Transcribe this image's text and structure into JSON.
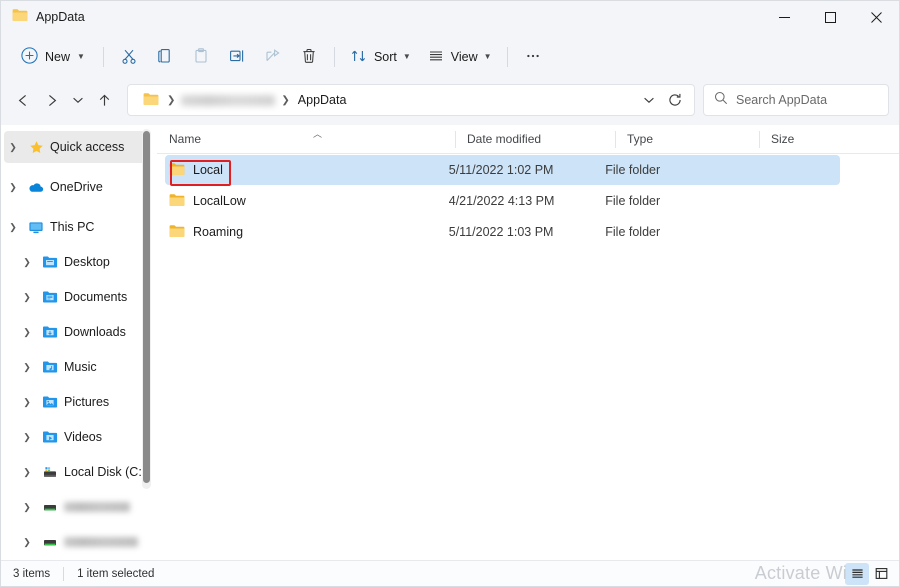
{
  "window": {
    "title": "AppData",
    "title_icon": "folder-icon",
    "controls": {
      "minimize": "minimize-icon",
      "maximize": "maximize-icon",
      "close": "close-icon"
    }
  },
  "toolbar": {
    "new_label": "New",
    "items": [
      {
        "name": "new-button",
        "label": "New",
        "icon": "plus-circle-icon",
        "has_chevron": true,
        "disabled": false
      },
      {
        "name": "cut-button",
        "label": "",
        "icon": "scissors-icon",
        "has_chevron": false,
        "disabled": false
      },
      {
        "name": "copy-button",
        "label": "",
        "icon": "copy-icon",
        "has_chevron": false,
        "disabled": false
      },
      {
        "name": "paste-button",
        "label": "",
        "icon": "paste-icon",
        "has_chevron": false,
        "disabled": true
      },
      {
        "name": "rename-button",
        "label": "",
        "icon": "rename-icon",
        "has_chevron": false,
        "disabled": false
      },
      {
        "name": "share-button",
        "label": "",
        "icon": "share-icon",
        "has_chevron": false,
        "disabled": true
      },
      {
        "name": "delete-button",
        "label": "",
        "icon": "trash-icon",
        "has_chevron": false,
        "disabled": false
      },
      {
        "name": "sort-button",
        "label": "Sort",
        "icon": "sort-icon",
        "has_chevron": true,
        "disabled": false
      },
      {
        "name": "view-button",
        "label": "View",
        "icon": "view-icon",
        "has_chevron": true,
        "disabled": false
      },
      {
        "name": "more-button",
        "label": "",
        "icon": "ellipsis-icon",
        "has_chevron": false,
        "disabled": false
      }
    ],
    "sort_label": "Sort",
    "view_label": "View"
  },
  "addressbar": {
    "back_icon": "back-arrow-icon",
    "forward_icon": "forward-arrow-icon",
    "recent_icon": "chevron-down-icon",
    "up_icon": "up-arrow-icon",
    "refresh_icon": "refresh-icon",
    "dropdown_icon": "chevron-down-icon",
    "breadcrumbs": [
      {
        "label": "",
        "icon": "folder-icon",
        "blurred": false
      },
      {
        "label": "",
        "icon": "",
        "blurred": true
      },
      {
        "label": "AppData",
        "icon": "",
        "blurred": false
      }
    ],
    "separator": "›"
  },
  "search": {
    "placeholder": "Search AppData",
    "value": "",
    "icon": "search-icon"
  },
  "sidebar": {
    "items": [
      {
        "label": "Quick access",
        "icon": "star-icon",
        "expander": "chevron-right",
        "indent": false,
        "selected": true,
        "blurred": false
      },
      {
        "label": "OneDrive",
        "icon": "cloud-icon",
        "expander": "chevron-right",
        "indent": false,
        "selected": false,
        "blurred": false
      },
      {
        "label": "This PC",
        "icon": "monitor-icon",
        "expander": "chevron-down",
        "indent": false,
        "selected": false,
        "blurred": false
      },
      {
        "label": "Desktop",
        "icon": "folder-desktop-icon",
        "expander": "chevron-right",
        "indent": true,
        "selected": false,
        "blurred": false
      },
      {
        "label": "Documents",
        "icon": "folder-documents-icon",
        "expander": "chevron-right",
        "indent": true,
        "selected": false,
        "blurred": false
      },
      {
        "label": "Downloads",
        "icon": "folder-downloads-icon",
        "expander": "chevron-right",
        "indent": true,
        "selected": false,
        "blurred": false
      },
      {
        "label": "Music",
        "icon": "folder-music-icon",
        "expander": "chevron-right",
        "indent": true,
        "selected": false,
        "blurred": false
      },
      {
        "label": "Pictures",
        "icon": "folder-pictures-icon",
        "expander": "chevron-right",
        "indent": true,
        "selected": false,
        "blurred": false
      },
      {
        "label": "Videos",
        "icon": "folder-videos-icon",
        "expander": "chevron-right",
        "indent": true,
        "selected": false,
        "blurred": false
      },
      {
        "label": "Local Disk (C:)",
        "icon": "drive-icon",
        "expander": "chevron-right",
        "indent": true,
        "selected": false,
        "blurred": false
      },
      {
        "label": "",
        "icon": "network-drive-icon",
        "expander": "chevron-right",
        "indent": true,
        "selected": false,
        "blurred": true
      },
      {
        "label": "",
        "icon": "network-drive-icon",
        "expander": "chevron-right",
        "indent": true,
        "selected": false,
        "blurred": true
      },
      {
        "label": "",
        "icon": "network-drive-icon",
        "expander": "chevron-right",
        "indent": true,
        "selected": false,
        "blurred": true
      }
    ]
  },
  "filelist": {
    "columns": [
      {
        "key": "name",
        "label": "Name",
        "sorted": true,
        "sort_dir": "asc"
      },
      {
        "key": "date",
        "label": "Date modified",
        "sorted": false,
        "sort_dir": ""
      },
      {
        "key": "type",
        "label": "Type",
        "sorted": false,
        "sort_dir": ""
      },
      {
        "key": "size",
        "label": "Size",
        "sorted": false,
        "sort_dir": ""
      }
    ],
    "sort_caret": "⌃",
    "rows": [
      {
        "name": "Local",
        "date": "5/11/2022 1:02 PM",
        "type": "File folder",
        "size": "",
        "icon": "folder-icon",
        "selected": true,
        "highlighted": true
      },
      {
        "name": "LocalLow",
        "date": "4/21/2022 4:13 PM",
        "type": "File folder",
        "size": "",
        "icon": "folder-icon",
        "selected": false,
        "highlighted": false
      },
      {
        "name": "Roaming",
        "date": "5/11/2022 1:03 PM",
        "type": "File folder",
        "size": "",
        "icon": "folder-icon",
        "selected": false,
        "highlighted": false
      }
    ],
    "highlight_color": "#e02020",
    "selection_color": "#cde3f7"
  },
  "statusbar": {
    "item_count": "3 items",
    "selection_text": "1 item selected",
    "view_buttons": [
      {
        "name": "details-view-button",
        "icon": "details-view-icon",
        "active": true
      },
      {
        "name": "large-icons-view-button",
        "icon": "large-icons-view-icon",
        "active": false
      }
    ]
  },
  "watermark": {
    "text": "Activate Wi"
  }
}
